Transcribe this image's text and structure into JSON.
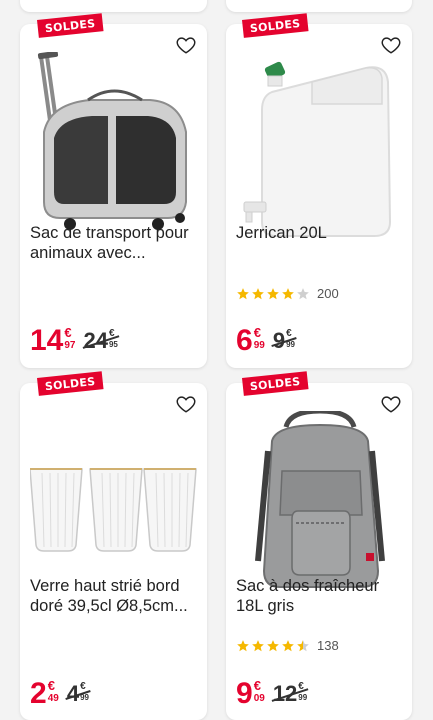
{
  "products": [
    {
      "badge": "SOLDES",
      "title": "Sac de transport pour animaux avec...",
      "price_int": "14",
      "price_currency": "€",
      "price_cents": "97",
      "old_int": "24",
      "old_currency": "€",
      "old_cents": "95",
      "icon": "pet-carrier-image"
    },
    {
      "badge": "SOLDES",
      "title": "Jerrican 20L",
      "rating_value": 4,
      "rating_count": "200",
      "price_int": "6",
      "price_currency": "€",
      "price_cents": "99",
      "old_int": "9",
      "old_currency": "€",
      "old_cents": "99",
      "icon": "jerrycan-image"
    },
    {
      "badge": "SOLDES",
      "title": "Verre haut strié bord doré 39,5cl Ø8,5cm...",
      "price_int": "2",
      "price_currency": "€",
      "price_cents": "49",
      "old_int": "4",
      "old_currency": "€",
      "old_cents": "99",
      "icon": "glasses-image"
    },
    {
      "badge": "SOLDES",
      "title": "Sac à dos fraîcheur 18L gris",
      "rating_value": 4.5,
      "rating_count": "138",
      "price_int": "9",
      "price_currency": "€",
      "price_cents": "09",
      "old_int": "12",
      "old_currency": "€",
      "old_cents": "99",
      "icon": "backpack-image"
    }
  ],
  "colors": {
    "accent_red": "#e4032e",
    "star_yellow": "#f5b800",
    "star_empty": "#cfcfcf",
    "background": "#f3f3f3"
  }
}
